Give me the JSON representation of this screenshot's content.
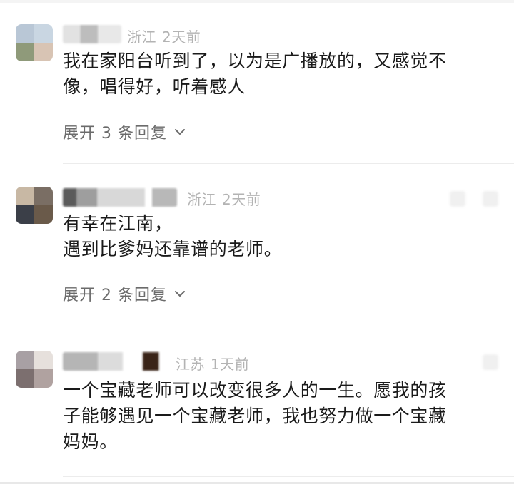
{
  "comments": [
    {
      "location": "浙江",
      "time": "2天前",
      "text": "我在家阳台听到了，以为是广播放的，又感觉不\n像，唱得好，听着感人",
      "expand_label": "展开 3 条回复",
      "colors": {
        "avatar": [
          "#b9c7d6",
          "#c9d6e2",
          "#8f9a7a",
          "#d8c4b4"
        ],
        "name": "#c8c8c8"
      }
    },
    {
      "location": "浙江",
      "time": "2天前",
      "text": "有幸在江南，\n遇到比爹妈还靠谱的老师。",
      "expand_label": "展开 2 条回复",
      "colors": {
        "avatar": [
          "#c8b8a4",
          "#7a6e64",
          "#3b3f48",
          "#6a5a4a"
        ],
        "name": "#8a8a8a"
      }
    },
    {
      "location": "江苏",
      "time": "1天前",
      "text": "一个宝藏老师可以改变很多人的一生。愿我的孩\n子能够遇见一个宝藏老师，我也努力做一个宝藏\n妈妈。",
      "expand_label": "",
      "colors": {
        "avatar": [
          "#a8a0a4",
          "#e6e0dc",
          "#7c6f6f",
          "#b0a2a0"
        ],
        "name": "#a6a6a6"
      }
    }
  ],
  "icons": {
    "expand": "chevron-down-icon"
  },
  "theme": {
    "meta_color": "#b3b3b3",
    "text_color": "#1a1a1a",
    "expand_color": "#6b6b6b"
  }
}
